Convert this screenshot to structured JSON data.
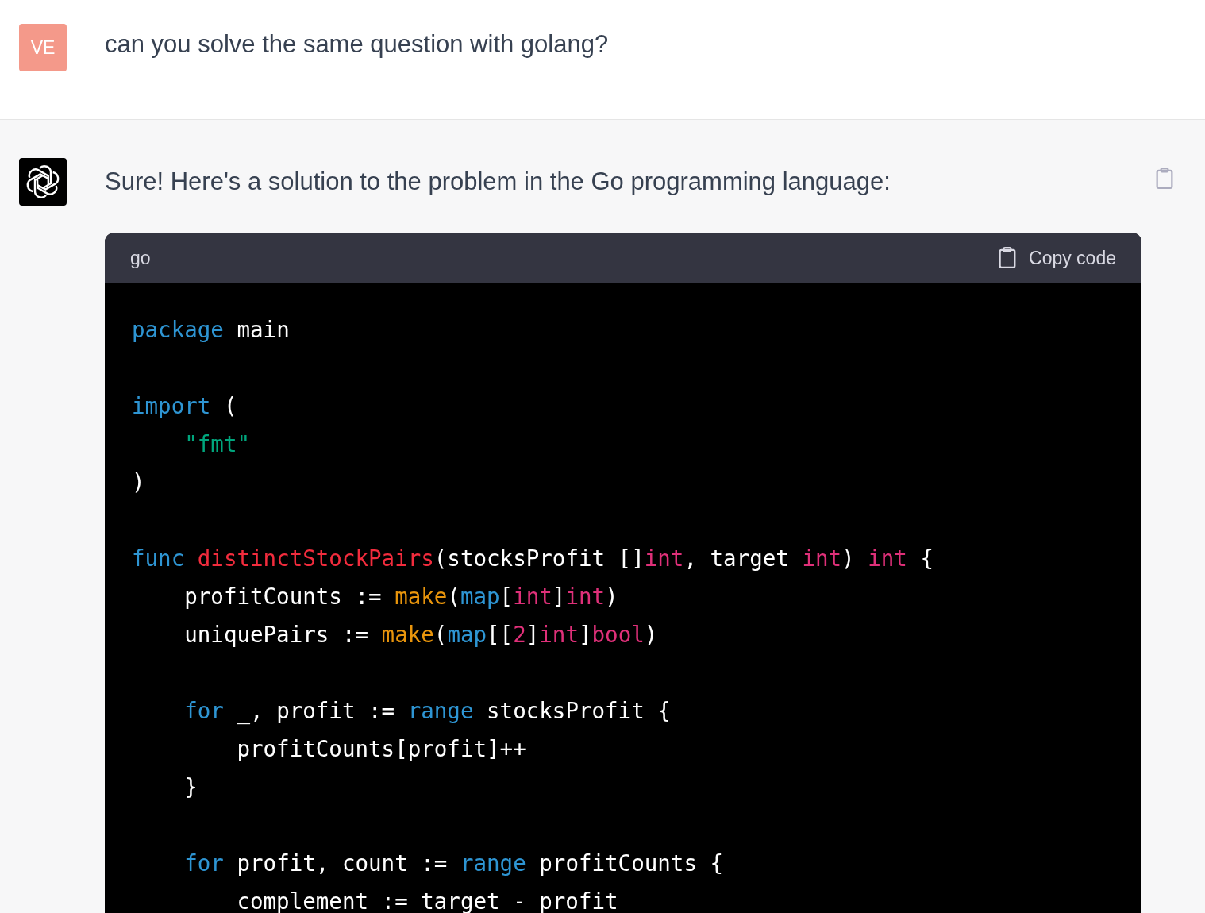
{
  "user_message": {
    "avatar": "VE",
    "text": "can you solve the same question with golang?"
  },
  "assistant_message": {
    "text": "Sure! Here's a solution to the problem in the Go programming language:",
    "code_block": {
      "language": "go",
      "copy_label": "Copy code",
      "lines": [
        {
          "kind": "code",
          "tokens": [
            {
              "kind": "keyword",
              "text": "package"
            },
            {
              "kind": "plain",
              "text": " main"
            }
          ]
        },
        {
          "kind": "blank"
        },
        {
          "kind": "code",
          "tokens": [
            {
              "kind": "keyword",
              "text": "import"
            },
            {
              "kind": "plain",
              "text": " ("
            }
          ]
        },
        {
          "kind": "code",
          "tokens": [
            {
              "kind": "string",
              "text": "    \"fmt\""
            }
          ]
        },
        {
          "kind": "code",
          "tokens": [
            {
              "kind": "plain",
              "text": ")"
            }
          ]
        },
        {
          "kind": "blank"
        },
        {
          "kind": "code",
          "tokens": [
            {
              "kind": "keyword",
              "text": "func "
            },
            {
              "kind": "title",
              "text": "distinctStockPairs"
            },
            {
              "kind": "plain",
              "text": "(stocksProfit []"
            },
            {
              "kind": "type",
              "text": "int"
            },
            {
              "kind": "plain",
              "text": ", target "
            },
            {
              "kind": "type",
              "text": "int"
            },
            {
              "kind": "plain",
              "text": ") "
            },
            {
              "kind": "type",
              "text": "int"
            },
            {
              "kind": "plain",
              "text": " {"
            }
          ]
        },
        {
          "kind": "code",
          "tokens": [
            {
              "kind": "plain",
              "text": "    profitCounts := "
            },
            {
              "kind": "builtin",
              "text": "make"
            },
            {
              "kind": "plain",
              "text": "("
            },
            {
              "kind": "keyword",
              "text": "map"
            },
            {
              "kind": "plain",
              "text": "["
            },
            {
              "kind": "type",
              "text": "int"
            },
            {
              "kind": "plain",
              "text": "]"
            },
            {
              "kind": "type",
              "text": "int"
            },
            {
              "kind": "plain",
              "text": ")"
            }
          ]
        },
        {
          "kind": "code",
          "tokens": [
            {
              "kind": "plain",
              "text": "    uniquePairs := "
            },
            {
              "kind": "builtin",
              "text": "make"
            },
            {
              "kind": "plain",
              "text": "("
            },
            {
              "kind": "keyword",
              "text": "map"
            },
            {
              "kind": "plain",
              "text": "[["
            },
            {
              "kind": "number",
              "text": "2"
            },
            {
              "kind": "plain",
              "text": "]"
            },
            {
              "kind": "type",
              "text": "int"
            },
            {
              "kind": "plain",
              "text": "]"
            },
            {
              "kind": "type",
              "text": "bool"
            },
            {
              "kind": "plain",
              "text": ")"
            }
          ]
        },
        {
          "kind": "blank"
        },
        {
          "kind": "code",
          "tokens": [
            {
              "kind": "keyword",
              "text": "    for"
            },
            {
              "kind": "plain",
              "text": " _, profit := "
            },
            {
              "kind": "keyword",
              "text": "range"
            },
            {
              "kind": "plain",
              "text": " stocksProfit {"
            }
          ]
        },
        {
          "kind": "code",
          "tokens": [
            {
              "kind": "plain",
              "text": "        profitCounts[profit]++"
            }
          ]
        },
        {
          "kind": "code",
          "tokens": [
            {
              "kind": "plain",
              "text": "    }"
            }
          ]
        },
        {
          "kind": "blank"
        },
        {
          "kind": "code",
          "tokens": [
            {
              "kind": "keyword",
              "text": "    for"
            },
            {
              "kind": "plain",
              "text": " profit, count := "
            },
            {
              "kind": "keyword",
              "text": "range"
            },
            {
              "kind": "plain",
              "text": " profitCounts {"
            }
          ]
        },
        {
          "kind": "code",
          "tokens": [
            {
              "kind": "plain",
              "text": "        complement := target - profit"
            }
          ]
        }
      ]
    }
  }
}
